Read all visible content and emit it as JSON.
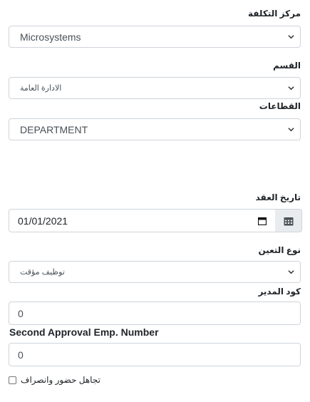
{
  "cost_center": {
    "label": "مركز التكلفة",
    "value": "Microsystems"
  },
  "department": {
    "label": "القسم",
    "value": "الادارة العامة"
  },
  "sectors": {
    "label": "القطاعات",
    "value": "DEPARTMENT"
  },
  "contract_date": {
    "label": "تاريخ العقد",
    "value": "01/01/2021"
  },
  "employment_type": {
    "label": "نوع التعين",
    "value": "توظيف مؤقت"
  },
  "manager_code": {
    "label": "كود المدير",
    "value": "0"
  },
  "second_approval": {
    "label": "Second Approval Emp. Number",
    "value": "0"
  },
  "ignore_attendance": {
    "label": "تجاهل حضور وانصراف",
    "checked": false
  },
  "icons": {
    "chevron": "chevron-down-icon",
    "calendar": "calendar-icon"
  }
}
